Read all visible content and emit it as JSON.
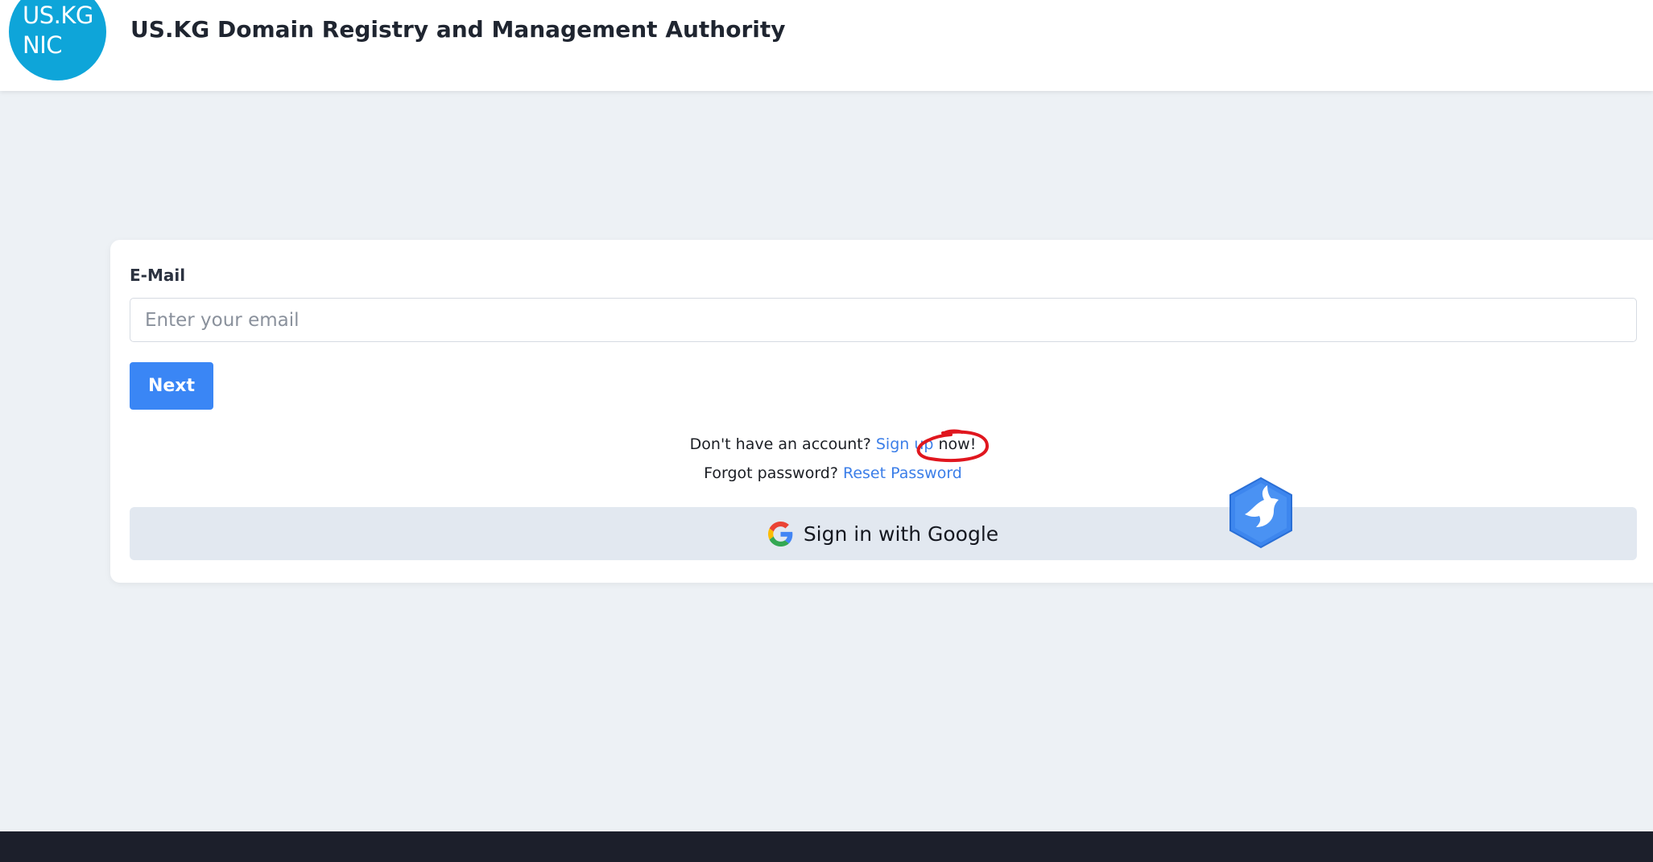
{
  "header": {
    "logo_line1": "US.KG",
    "logo_line2": "NIC",
    "title": "US.KG Domain Registry and Management Authority"
  },
  "login": {
    "email_label": "E-Mail",
    "email_placeholder": "Enter your email",
    "email_value": "",
    "next_label": "Next",
    "signup_prefix": "Don't have an account?",
    "signup_link": "Sign up",
    "signup_suffix": "now!",
    "forgot_prefix": "Forgot password?",
    "reset_link": "Reset Password",
    "google_label": "Sign in with Google"
  },
  "icons": {
    "logo": "logo-icon",
    "google": "google-icon",
    "bird": "bird-icon"
  },
  "colors": {
    "accent": "#3a86f5",
    "link": "#3b7ee8",
    "logo_bg": "#0ea5d9",
    "annotation": "#e0161e",
    "footer": "#1c1f2b"
  }
}
